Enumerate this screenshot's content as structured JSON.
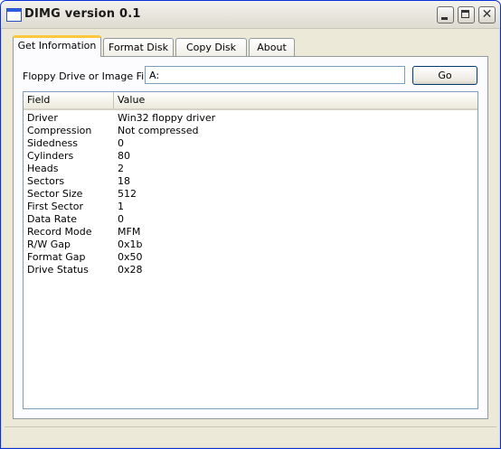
{
  "window": {
    "title": "DIMG version 0.1",
    "icon": "app-window-icon",
    "controls": [
      "minimize-icon",
      "maximize-icon",
      "close-icon"
    ]
  },
  "tabs": [
    {
      "label": "Get Information",
      "active": true
    },
    {
      "label": "Format Disk",
      "active": false
    },
    {
      "label": "Copy Disk",
      "active": false
    },
    {
      "label": "About",
      "active": false
    }
  ],
  "drive": {
    "label": "Floppy Drive or Image File:",
    "value": "A:",
    "button": "Go"
  },
  "list": {
    "columns": [
      "Field",
      "Value"
    ],
    "rows": [
      {
        "field": "Driver",
        "value": "Win32 floppy driver"
      },
      {
        "field": "Compression",
        "value": "Not compressed"
      },
      {
        "field": "Sidedness",
        "value": "0"
      },
      {
        "field": "Cylinders",
        "value": "80"
      },
      {
        "field": "Heads",
        "value": "2"
      },
      {
        "field": "Sectors",
        "value": "18"
      },
      {
        "field": "Sector Size",
        "value": "512"
      },
      {
        "field": "First Sector",
        "value": "1"
      },
      {
        "field": "Data Rate",
        "value": "0"
      },
      {
        "field": "Record Mode",
        "value": "MFM"
      },
      {
        "field": "R/W Gap",
        "value": "0x1b"
      },
      {
        "field": "Format Gap",
        "value": "0x50"
      },
      {
        "field": "Drive Status",
        "value": "0x28"
      }
    ]
  },
  "colors": {
    "tab_highlight": "#ffc73c",
    "window_bg": "#ece9d8",
    "border": "#7f9db9"
  }
}
